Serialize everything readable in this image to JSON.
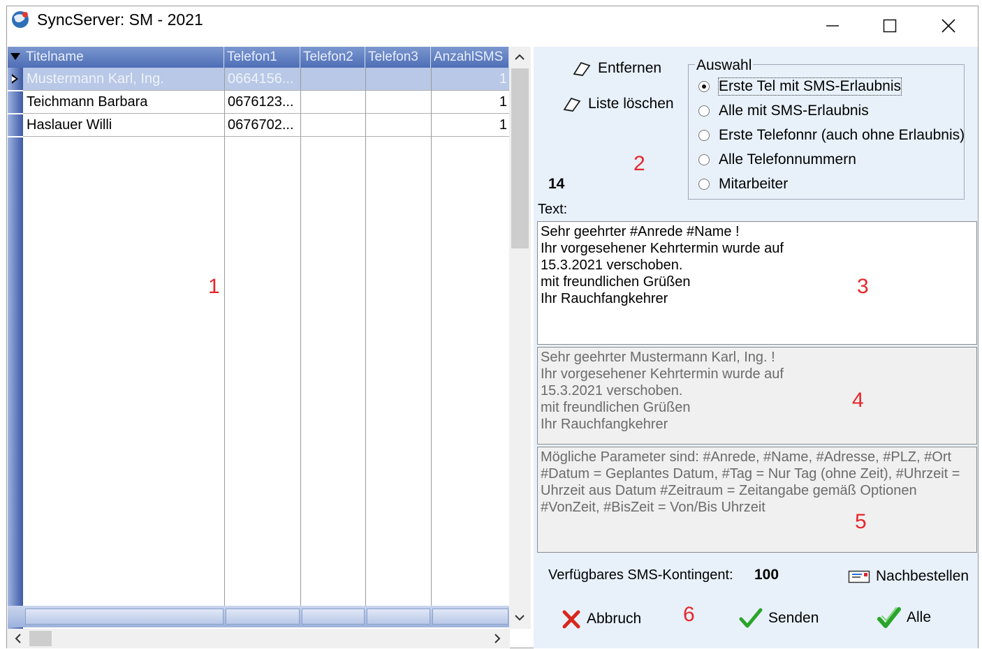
{
  "window": {
    "title": "SyncServer: SM - 2021"
  },
  "grid": {
    "columns": [
      "Titelname",
      "Telefon1",
      "Telefon2",
      "Telefon3",
      "AnzahlSMS"
    ],
    "rows": [
      {
        "name": "Mustermann Karl, Ing.",
        "tel1": "0664156...",
        "tel2": "",
        "tel3": "",
        "count": "1",
        "selected": true
      },
      {
        "name": "Teichmann Barbara",
        "tel1": "0676123...",
        "tel2": "",
        "tel3": "",
        "count": "1"
      },
      {
        "name": "Haslauer Willi",
        "tel1": "0676702...",
        "tel2": "",
        "tel3": "",
        "count": "1"
      }
    ]
  },
  "actions": {
    "remove_label": "Entfernen",
    "clear_label": "Liste löschen"
  },
  "selection": {
    "title": "Auswahl",
    "options": [
      "Erste Tel mit SMS-Erlaubnis",
      "Alle mit SMS-Erlaubnis",
      "Erste Telefonnr (auch ohne Erlaubnis)",
      "Alle Telefonnummern",
      "Mitarbeiter"
    ],
    "selected_index": 0
  },
  "count": "14",
  "text_label": "Text:",
  "message_template": "Sehr geehrter #Anrede #Name !\nIhr vorgesehener Kehrtermin wurde auf\n15.3.2021 verschoben.\nmit freundlichen Grüßen\nIhr Rauchfangkehrer",
  "message_preview": "Sehr geehrter  Mustermann Karl, Ing. !\nIhr vorgesehener Kehrtermin wurde auf\n15.3.2021 verschoben.\nmit freundlichen Grüßen\nIhr Rauchfangkehrer",
  "parameters_help": "Mögliche Parameter sind: #Anrede, #Name, #Adresse, #PLZ, #Ort\n#Datum = Geplantes Datum, #Tag = Nur Tag (ohne Zeit), #Uhrzeit =\nUhrzeit aus Datum  #Zeitraum = Zeitangabe gemäß Optionen\n#VonZeit, #BisZeit = Von/Bis Uhrzeit",
  "quota": {
    "label": "Verfügbares SMS-Kontingent:",
    "value": "100",
    "reorder_label": "Nachbestellen"
  },
  "bottom_buttons": {
    "cancel": "Abbruch",
    "send": "Senden",
    "all": "Alle"
  },
  "annotations": [
    "1",
    "2",
    "3",
    "4",
    "5",
    "6"
  ],
  "colors": {
    "header_blue": "#4e6eb6",
    "selected_row": "#b8c8e6",
    "panel_bg": "#e8f1fa",
    "annotation_red": "#e8262a",
    "check_green": "#2aa52a",
    "cancel_red": "#d9261c"
  }
}
